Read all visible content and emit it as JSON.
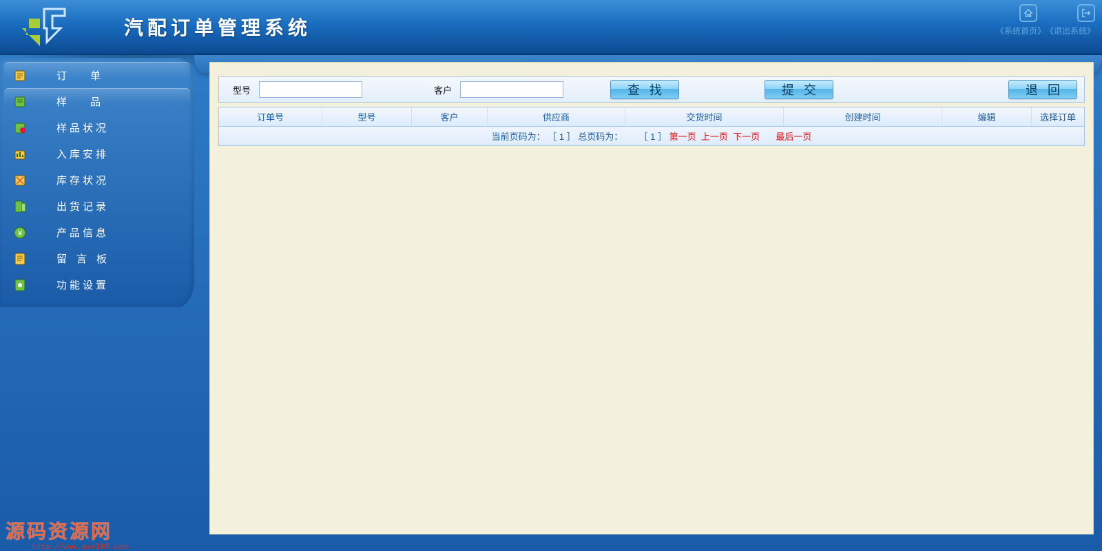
{
  "header": {
    "app_title": "汽配订单管理系统",
    "home_link": "《系统首页》",
    "exit_link": "《退出系统》"
  },
  "sidebar": {
    "items": [
      {
        "id": "order",
        "label": "订单",
        "kind": "top",
        "spacing": "wide"
      },
      {
        "id": "sample",
        "label": "样品",
        "kind": "top",
        "spacing": "wide"
      },
      {
        "id": "sample-status",
        "label": "样品状况",
        "kind": "sub",
        "spacing": "compact"
      },
      {
        "id": "inbound-plan",
        "label": "入库安排",
        "kind": "sub",
        "spacing": "compact"
      },
      {
        "id": "stock-status",
        "label": "库存状况",
        "kind": "sub",
        "spacing": "compact"
      },
      {
        "id": "ship-record",
        "label": "出货记录",
        "kind": "sub",
        "spacing": "compact"
      },
      {
        "id": "product-info",
        "label": "产品信息",
        "kind": "sub",
        "spacing": "compact"
      },
      {
        "id": "message-board",
        "label": "留言板",
        "kind": "sub",
        "spacing": "normal"
      },
      {
        "id": "settings",
        "label": "功能设置",
        "kind": "sub",
        "spacing": "compact"
      }
    ]
  },
  "filter": {
    "model_label": "型号",
    "customer_label": "客户",
    "model_value": "",
    "customer_value": "",
    "btn_search": "查找",
    "btn_submit": "提交",
    "btn_back": "退回"
  },
  "table": {
    "headers": [
      "订单号",
      "型号",
      "客户",
      "供应商",
      "交货时间",
      "创建时间",
      "编辑",
      "选择订单"
    ]
  },
  "pager": {
    "prefix": "当前页码为：",
    "current_page": "［ 1 ］",
    "total_prefix": "总页码为：",
    "total_pages": "［ 1 ］",
    "first": "第一页",
    "prev": "上一页",
    "next": "下一页",
    "last": "最后一页"
  },
  "watermark": {
    "text": "源码资源网",
    "url": "http://www.axr100.com"
  }
}
